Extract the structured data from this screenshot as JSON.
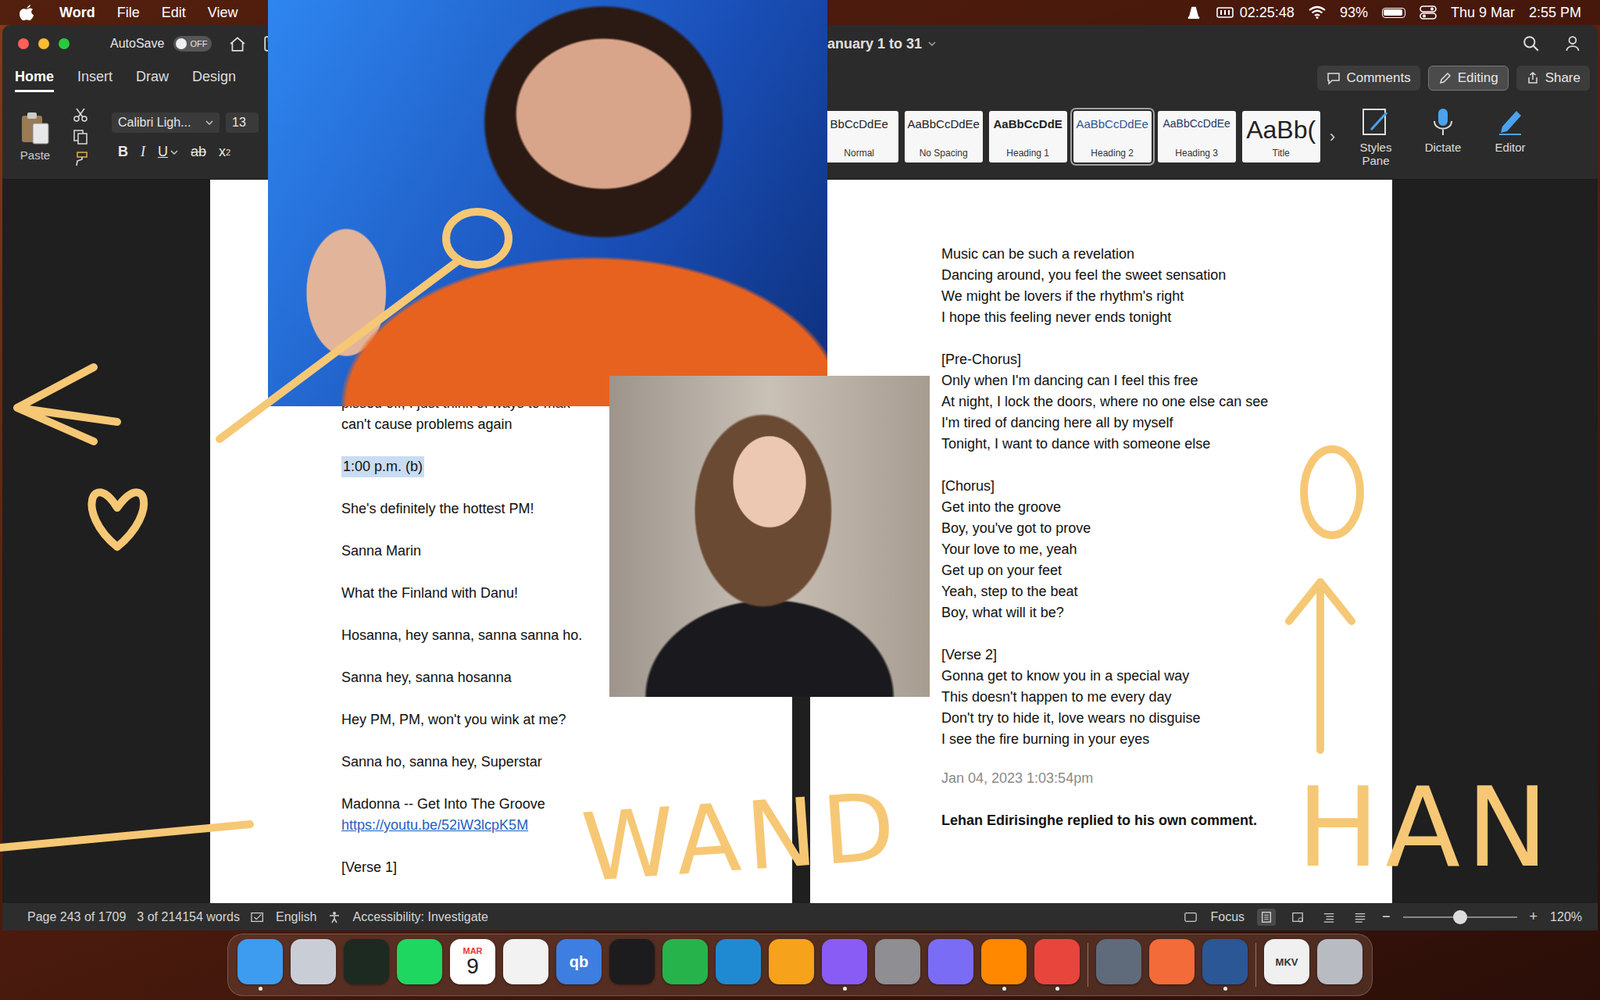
{
  "menubar": {
    "app": "Word",
    "items": [
      "File",
      "Edit",
      "View"
    ],
    "timer": "02:25:48",
    "battery": {
      "reading": "93%",
      "level": 0.93
    },
    "date": "Thu 9 Mar",
    "time": "2:55 PM"
  },
  "window": {
    "title": "anuary 1 to 31",
    "autosave": {
      "label": "AutoSave",
      "state": "OFF",
      "on": false
    }
  },
  "tabs": [
    {
      "label": "Home",
      "selected": true
    },
    {
      "label": "Insert",
      "selected": false
    },
    {
      "label": "Draw",
      "selected": false
    },
    {
      "label": "Design",
      "selected": false
    }
  ],
  "tab_buttons": [
    {
      "label": "Comments",
      "kind": "comments",
      "selected": false
    },
    {
      "label": "Editing",
      "kind": "editing",
      "selected": true
    },
    {
      "label": "Share",
      "kind": "share",
      "selected": false
    }
  ],
  "clipboard": {
    "paste": "Paste"
  },
  "font": {
    "family": "Calibri Ligh...",
    "size": "13"
  },
  "format": [
    {
      "label": "B",
      "sub": "",
      "kind": "bold"
    },
    {
      "label": "I",
      "sub": "",
      "kind": "italic"
    },
    {
      "label": "U",
      "sub": "",
      "kind": "underline"
    },
    {
      "label": "ab",
      "sub": "",
      "kind": "strike"
    },
    {
      "label": "x",
      "sub": "2",
      "kind": "subscript"
    }
  ],
  "styles": [
    {
      "sample": "BbCcDdEe",
      "label": "Normal",
      "kind": "normal",
      "selected": false
    },
    {
      "sample": "AaBbCcDdEe",
      "label": "No Spacing",
      "kind": "normal",
      "selected": false
    },
    {
      "sample": "AaBbCcDdE",
      "label": "Heading 1",
      "kind": "heading1",
      "selected": false
    },
    {
      "sample": "AaBbCcDdEe",
      "label": "Heading 2",
      "kind": "heading2",
      "selected": true
    },
    {
      "sample": "AaBbCcDdEe",
      "label": "Heading 3",
      "kind": "heading3",
      "selected": false
    },
    {
      "sample": "AaBb(",
      "label": "Title",
      "kind": "title",
      "selected": false
    }
  ],
  "styles_more": "›",
  "tools": [
    {
      "label": "Styles Pane",
      "kind": "styles"
    },
    {
      "label": "Dictate",
      "kind": "dictate"
    },
    {
      "label": "Editor",
      "kind": "editor"
    }
  ],
  "left_page": {
    "paragraphs": [
      {
        "lines": [
          {
            "text": "pissed off, I just think of ways to mak",
            "kind": "text"
          },
          {
            "text": "can't cause problems again",
            "kind": "text"
          }
        ]
      },
      {
        "lines": [
          {
            "text": "1:00 p.m. (b)",
            "kind": "highlight"
          }
        ]
      },
      {
        "lines": [
          {
            "text": "She's definitely the hottest PM!",
            "kind": "text"
          }
        ]
      },
      {
        "lines": [
          {
            "text": "Sanna Marin",
            "kind": "text"
          }
        ]
      },
      {
        "lines": [
          {
            "text": "What the Finland with Danu!",
            "kind": "text"
          }
        ]
      },
      {
        "lines": [
          {
            "text": "Hosanna, hey sanna, sanna sanna ho.",
            "kind": "text"
          }
        ]
      },
      {
        "lines": [
          {
            "text": "Sanna hey, sanna hosanna",
            "kind": "text"
          }
        ]
      },
      {
        "lines": [
          {
            "text": "Hey PM, PM, won't you wink at me?",
            "kind": "text"
          }
        ]
      },
      {
        "lines": [
          {
            "text": "Sanna ho, sanna hey, Superstar",
            "kind": "text"
          }
        ]
      },
      {
        "lines": [
          {
            "text": "Madonna -- Get Into The Groove",
            "kind": "text"
          },
          {
            "text": "https://youtu.be/52iW3lcpK5M",
            "kind": "link"
          }
        ]
      },
      {
        "lines": [
          {
            "text": "[Verse 1]",
            "kind": "text"
          }
        ]
      }
    ]
  },
  "right_page": {
    "stanzas": [
      [
        "Music can be such a revelation",
        "Dancing around, you feel the sweet sensation",
        "We might be lovers if the rhythm's right",
        "I hope this feeling never ends tonight"
      ],
      [
        "[Pre-Chorus]",
        "Only when I'm dancing can I feel this free",
        "At night, I lock the doors, where no one else can see",
        "I'm tired of dancing here all by myself",
        "Tonight, I want to dance with someone else"
      ],
      [
        "[Chorus]",
        "Get into the groove",
        "Boy, you've got to prove",
        "Your love to me, yeah",
        "Get up on your feet",
        "Yeah, step to the beat",
        "Boy, what will it be?"
      ],
      [
        "[Verse 2]",
        "Gonna get to know you in a special way",
        "This doesn't happen to me every day",
        "Don't try to hide it, love wears no disguise",
        "I see the fire burning in your eyes"
      ]
    ],
    "timestamp": "Jan 04, 2023 1:03:54pm",
    "comment": "Lehan Edirisinghe replied to his own comment."
  },
  "status_bar": {
    "page": "Page 243 of 1709",
    "words": "3 of 214154 words",
    "language": "English",
    "accessibility": "Accessibility: Investigate",
    "focus": "Focus",
    "views": [
      {
        "kind": "print",
        "selected": true
      },
      {
        "kind": "web",
        "selected": false
      },
      {
        "kind": "outline",
        "selected": false
      },
      {
        "kind": "draft",
        "selected": false
      }
    ],
    "zoom": {
      "minus": "−",
      "plus": "+",
      "level": 0.5,
      "reading": "120%"
    }
  },
  "dock": [
    {
      "kind": "app",
      "color": "#3d9bf0",
      "running": true,
      "text": "",
      "month": "",
      "day": ""
    },
    {
      "kind": "app",
      "color": "#c9ced6",
      "running": false,
      "text": "",
      "month": "",
      "day": ""
    },
    {
      "kind": "app",
      "color": "#1d2a22",
      "running": false,
      "text": "",
      "month": "",
      "day": ""
    },
    {
      "kind": "app",
      "color": "#1ed760",
      "running": false,
      "text": "",
      "month": "",
      "day": ""
    },
    {
      "kind": "calendar",
      "color": "#ffffff",
      "running": false,
      "text": "",
      "month": "MAR",
      "day": "9"
    },
    {
      "kind": "app",
      "color": "#f2f2f2",
      "running": false,
      "text": "",
      "month": "",
      "day": ""
    },
    {
      "kind": "label",
      "color": "#3d7ee0",
      "running": false,
      "text": "qb",
      "month": "",
      "day": ""
    },
    {
      "kind": "app",
      "color": "#1c1c1e",
      "running": false,
      "text": "",
      "month": "",
      "day": ""
    },
    {
      "kind": "app",
      "color": "#27b34b",
      "running": false,
      "text": "",
      "month": "",
      "day": ""
    },
    {
      "kind": "app",
      "color": "#1f8ad2",
      "running": false,
      "text": "",
      "month": "",
      "day": ""
    },
    {
      "kind": "app",
      "color": "#f7a21b",
      "running": false,
      "text": "",
      "month": "",
      "day": ""
    },
    {
      "kind": "app",
      "color": "#8a5cf6",
      "running": true,
      "text": "",
      "month": "",
      "day": ""
    },
    {
      "kind": "app",
      "color": "#8e8e93",
      "running": false,
      "text": "",
      "month": "",
      "day": ""
    },
    {
      "kind": "app",
      "color": "#7b6cf6",
      "running": false,
      "text": "",
      "month": "",
      "day": ""
    },
    {
      "kind": "app",
      "color": "#ff8800",
      "running": true,
      "text": "",
      "month": "",
      "day": ""
    },
    {
      "kind": "app",
      "color": "#e8453c",
      "running": true,
      "text": "",
      "month": "",
      "day": ""
    },
    {
      "kind": "separator",
      "color": "#ffffff",
      "running": false,
      "text": "",
      "month": "",
      "day": ""
    },
    {
      "kind": "app",
      "color": "#5f6b7a",
      "running": false,
      "text": "",
      "month": "",
      "day": ""
    },
    {
      "kind": "app",
      "color": "#f26b38",
      "running": false,
      "text": "",
      "month": "",
      "day": ""
    },
    {
      "kind": "app",
      "color": "#2b5797",
      "running": true,
      "text": "",
      "month": "",
      "day": ""
    },
    {
      "kind": "separator",
      "color": "#ffffff",
      "running": false,
      "text": "",
      "month": "",
      "day": ""
    },
    {
      "kind": "label",
      "color": "#f0f0f0",
      "running": false,
      "text": "MKV",
      "month": "",
      "day": ""
    },
    {
      "kind": "app",
      "color": "#b8bcc2",
      "running": false,
      "text": "",
      "month": "",
      "day": ""
    }
  ],
  "annotations": {
    "words": [
      "WAND",
      "HAN"
    ]
  }
}
